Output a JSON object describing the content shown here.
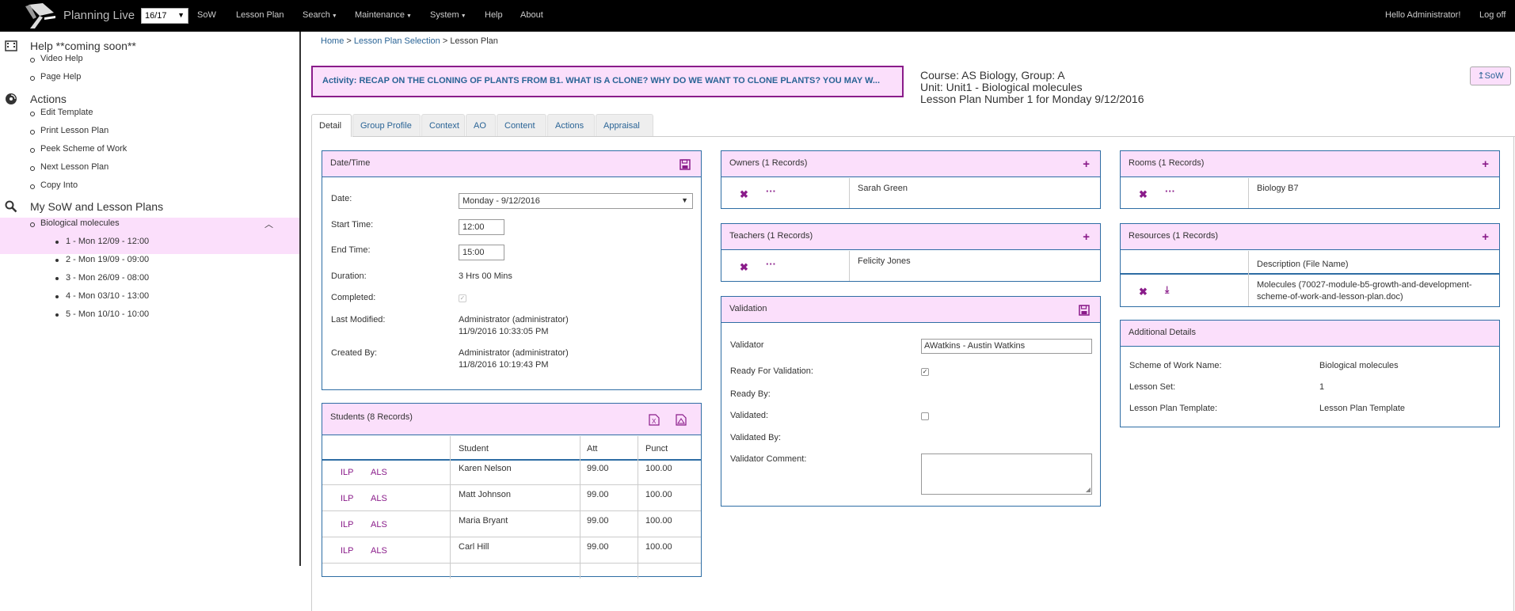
{
  "topbar": {
    "brand": "Planning Live",
    "year": "16/17",
    "nav": [
      {
        "label": "SoW",
        "dropdown": false
      },
      {
        "label": "Lesson Plan",
        "dropdown": false
      },
      {
        "label": "Search",
        "dropdown": true
      },
      {
        "label": "Maintenance",
        "dropdown": true
      },
      {
        "label": "System",
        "dropdown": true
      },
      {
        "label": "Help",
        "dropdown": false
      },
      {
        "label": "About",
        "dropdown": false
      }
    ],
    "greeting": "Hello Administrator!",
    "logoff": "Log off"
  },
  "sidebar": {
    "help": {
      "title": "Help **coming soon**",
      "icon": "film-icon",
      "items": [
        "Video Help",
        "Page Help"
      ]
    },
    "actions": {
      "title": "Actions",
      "icon": "cd-icon",
      "items": [
        "Edit Template",
        "Print Lesson Plan",
        "Peek Scheme of Work",
        "Next Lesson Plan",
        "Copy Into"
      ]
    },
    "mysow": {
      "title": "My SoW and Lesson Plans",
      "icon": "search-icon",
      "unit": "Biological molecules",
      "lessons": [
        "1 - Mon 12/09 - 12:00",
        "2 - Mon 19/09 - 09:00",
        "3 - Mon 26/09 - 08:00",
        "4 - Mon 03/10 - 13:00",
        "5 - Mon 10/10 - 10:00"
      ]
    }
  },
  "breadcrumb": {
    "home": "Home",
    "selection": "Lesson Plan Selection",
    "current": "Lesson Plan",
    "sep": ">"
  },
  "activity": "Activity: RECAP ON THE CLONING OF PLANTS FROM B1. WHAT IS A CLONE? WHY DO WE WANT TO CLONE PLANTS? YOU MAY W...",
  "course": {
    "line1": "Course: AS Biology, Group: A",
    "line2": "Unit: Unit1 - Biological molecules",
    "line3": "Lesson Plan Number 1 for Monday 9/12/2016"
  },
  "sow_button": "↥SoW",
  "tabs": [
    "Detail",
    "Group Profile",
    "Context",
    "AO",
    "Content",
    "Actions",
    "Appraisal"
  ],
  "datetime": {
    "title": "Date/Time",
    "date_label": "Date:",
    "date_value": "Monday - 9/12/2016",
    "start_label": "Start Time:",
    "start_value": "12:00",
    "end_label": "End Time:",
    "end_value": "15:00",
    "duration_label": "Duration:",
    "duration_value": "3 Hrs 00 Mins",
    "completed_label": "Completed:",
    "modified_label": "Last Modified:",
    "modified_by": "Administrator (administrator)",
    "modified_at": "11/9/2016 10:33:05 PM",
    "created_label": "Created By:",
    "created_by": "Administrator (administrator)",
    "created_at": "11/8/2016 10:19:43 PM"
  },
  "students": {
    "title": "Students (8 Records)",
    "columns": [
      "Student",
      "Att",
      "Punct"
    ],
    "link1": "ILP",
    "link2": "ALS",
    "rows": [
      {
        "name": "Karen Nelson",
        "att": "99.00",
        "punct": "100.00"
      },
      {
        "name": "Matt Johnson",
        "att": "99.00",
        "punct": "100.00"
      },
      {
        "name": "Maria Bryant",
        "att": "99.00",
        "punct": "100.00"
      },
      {
        "name": "Carl Hill",
        "att": "99.00",
        "punct": "100.00"
      }
    ]
  },
  "owners": {
    "title": "Owners (1 Records)",
    "name": "Sarah Green"
  },
  "teachers": {
    "title": "Teachers (1 Records)",
    "name": "Felicity Jones"
  },
  "validation": {
    "title": "Validation",
    "validator_label": "Validator",
    "validator_value": "AWatkins - Austin Watkins",
    "ready_label": "Ready For Validation:",
    "readyby_label": "Ready By:",
    "validated_label": "Validated:",
    "validatedby_label": "Validated By:",
    "comment_label": "Validator Comment:"
  },
  "rooms": {
    "title": "Rooms (1 Records)",
    "name": "Biology B7"
  },
  "resources": {
    "title": "Resources (1 Records)",
    "column": "Description (File Name)",
    "line1": "Molecules (70027-module-b5-growth-and-development-",
    "line2": "scheme-of-work-and-lesson-plan.doc)"
  },
  "details": {
    "title": "Additional Details",
    "sow_label": "Scheme of Work Name:",
    "sow_value": "Biological molecules",
    "set_label": "Lesson Set:",
    "set_value": "1",
    "tpl_label": "Lesson Plan Template:",
    "tpl_value": "Lesson Plan Template"
  }
}
